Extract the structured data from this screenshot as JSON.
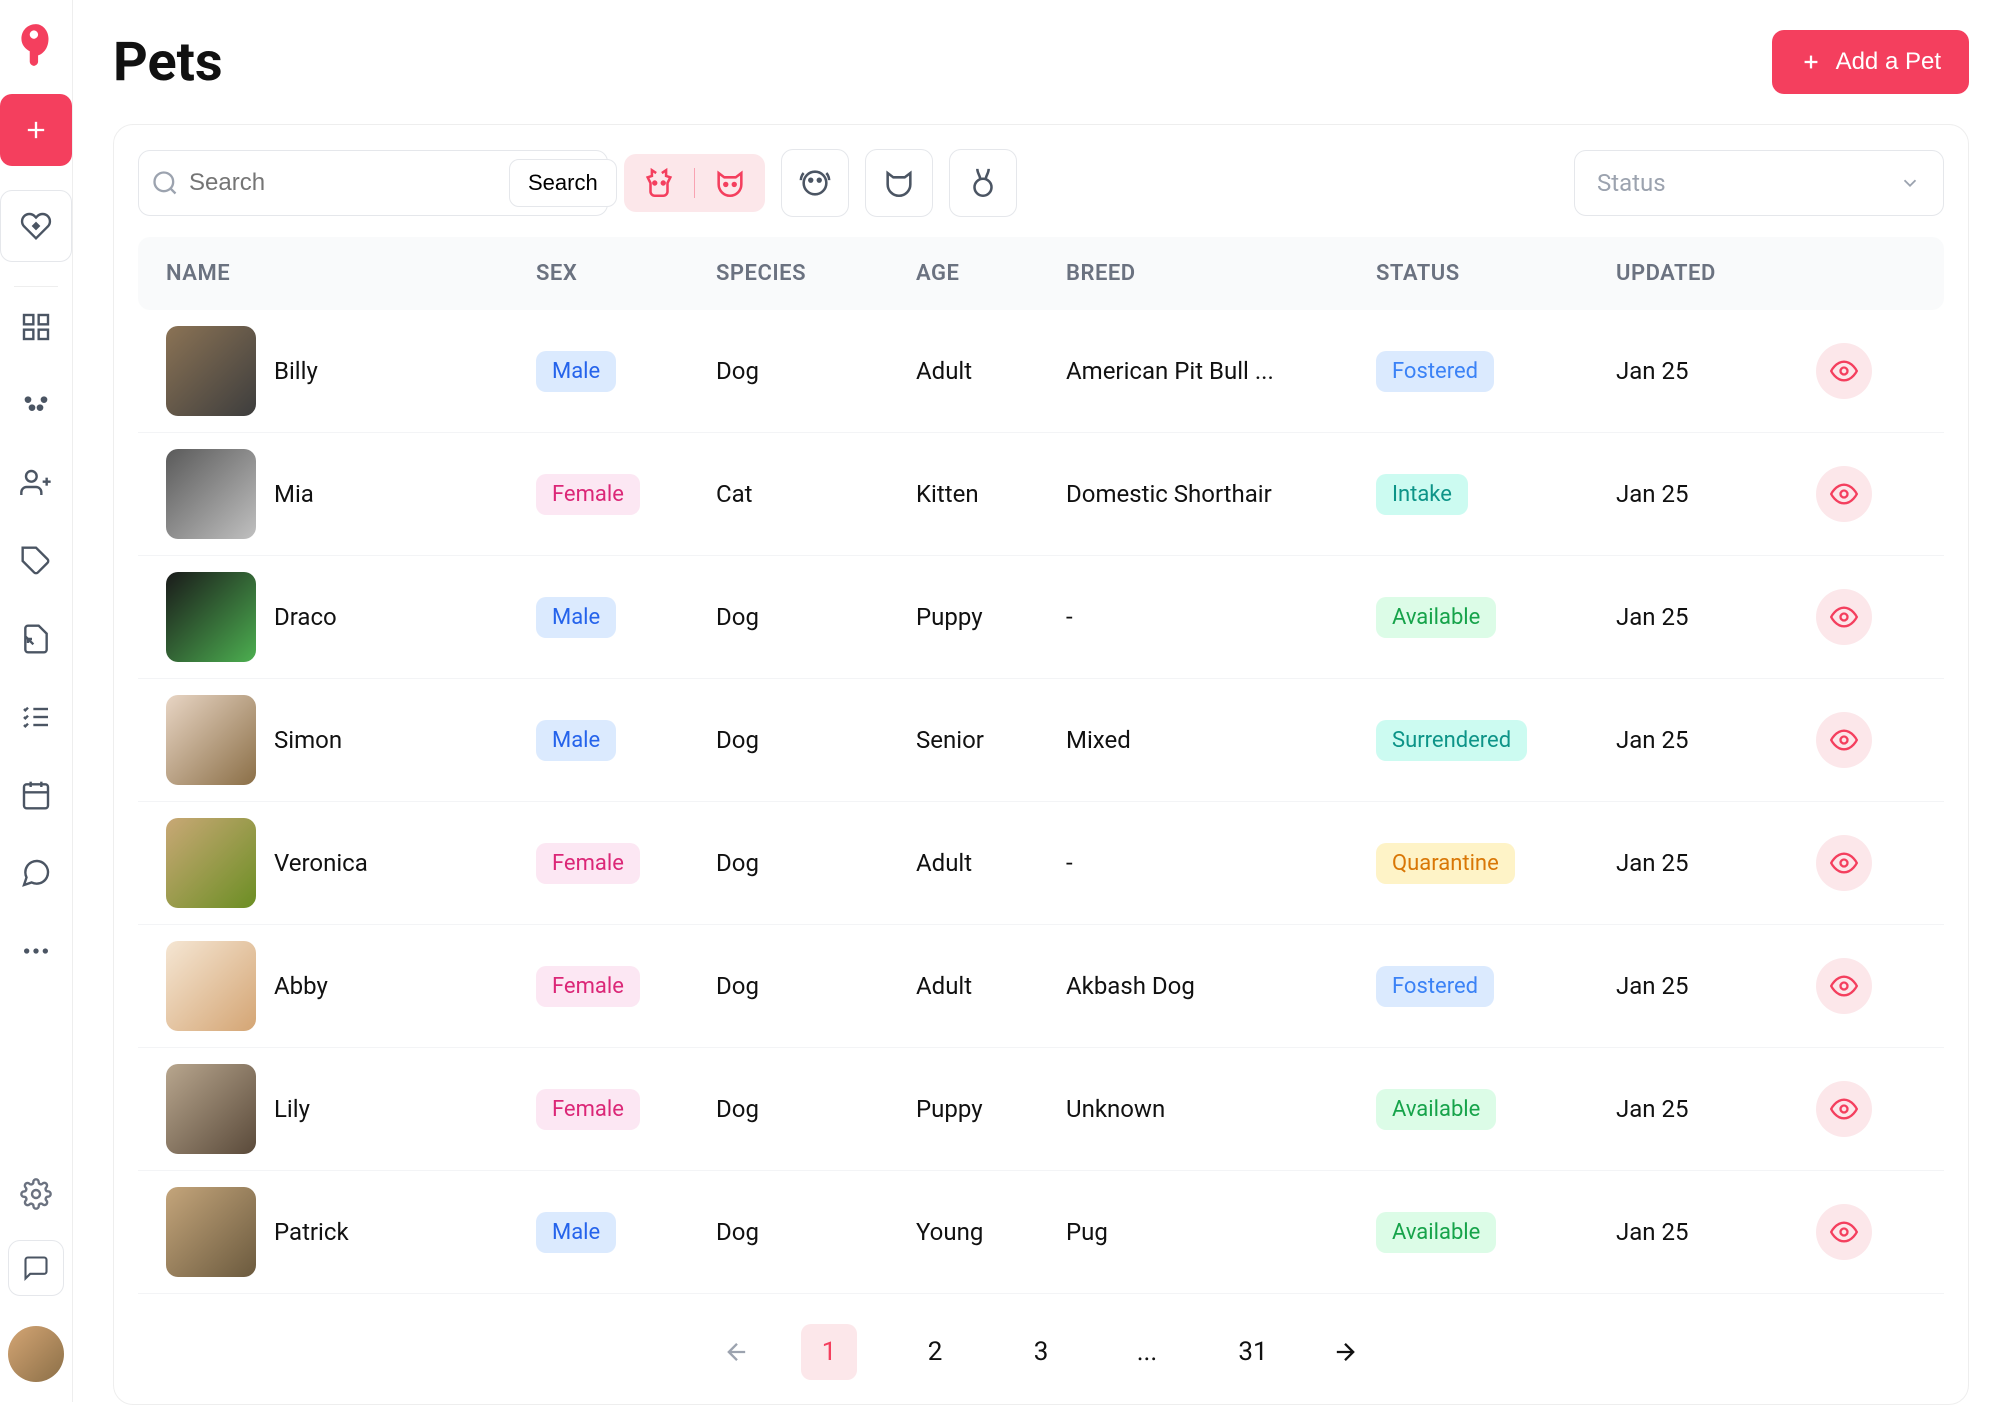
{
  "header": {
    "title": "Pets",
    "add_button": "Add a Pet"
  },
  "search": {
    "placeholder": "Search",
    "button": "Search"
  },
  "status_filter": {
    "label": "Status"
  },
  "columns": {
    "name": "NAME",
    "sex": "SEX",
    "species": "SPECIES",
    "age": "AGE",
    "breed": "BREED",
    "status": "STATUS",
    "updated": "UPDATED"
  },
  "pets": [
    {
      "name": "Billy",
      "sex": "Male",
      "species": "Dog",
      "age": "Adult",
      "breed": "American Pit Bull ...",
      "status": "Fostered",
      "updated": "Jan 25",
      "img": "linear-gradient(135deg,#8b7355,#3d3d3d)"
    },
    {
      "name": "Mia",
      "sex": "Female",
      "species": "Cat",
      "age": "Kitten",
      "breed": "Domestic Shorthair",
      "status": "Intake",
      "updated": "Jan 25",
      "img": "linear-gradient(135deg,#5a5a5a,#c0c0c0)"
    },
    {
      "name": "Draco",
      "sex": "Male",
      "species": "Dog",
      "age": "Puppy",
      "breed": "-",
      "status": "Available",
      "updated": "Jan 25",
      "img": "linear-gradient(135deg,#1a1a1a,#4caf50)"
    },
    {
      "name": "Simon",
      "sex": "Male",
      "species": "Dog",
      "age": "Senior",
      "breed": "Mixed",
      "status": "Surrendered",
      "updated": "Jan 25",
      "img": "linear-gradient(135deg,#e8d5c4,#8b6f47)"
    },
    {
      "name": "Veronica",
      "sex": "Female",
      "species": "Dog",
      "age": "Adult",
      "breed": "-",
      "status": "Quarantine",
      "updated": "Jan 25",
      "img": "linear-gradient(135deg,#c9a876,#6b8e23)"
    },
    {
      "name": "Abby",
      "sex": "Female",
      "species": "Dog",
      "age": "Adult",
      "breed": "Akbash Dog",
      "status": "Fostered",
      "updated": "Jan 25",
      "img": "linear-gradient(135deg,#f5e6d3,#d4a574)"
    },
    {
      "name": "Lily",
      "sex": "Female",
      "species": "Dog",
      "age": "Puppy",
      "breed": "Unknown",
      "status": "Available",
      "updated": "Jan 25",
      "img": "linear-gradient(135deg,#b8a68e,#5a4a3a)"
    },
    {
      "name": "Patrick",
      "sex": "Male",
      "species": "Dog",
      "age": "Young",
      "breed": "Pug",
      "status": "Available",
      "updated": "Jan 25",
      "img": "linear-gradient(135deg,#c4a57b,#6b5a3e)"
    }
  ],
  "pagination": {
    "pages": [
      "1",
      "2",
      "3",
      "...",
      "31"
    ],
    "current": "1"
  }
}
